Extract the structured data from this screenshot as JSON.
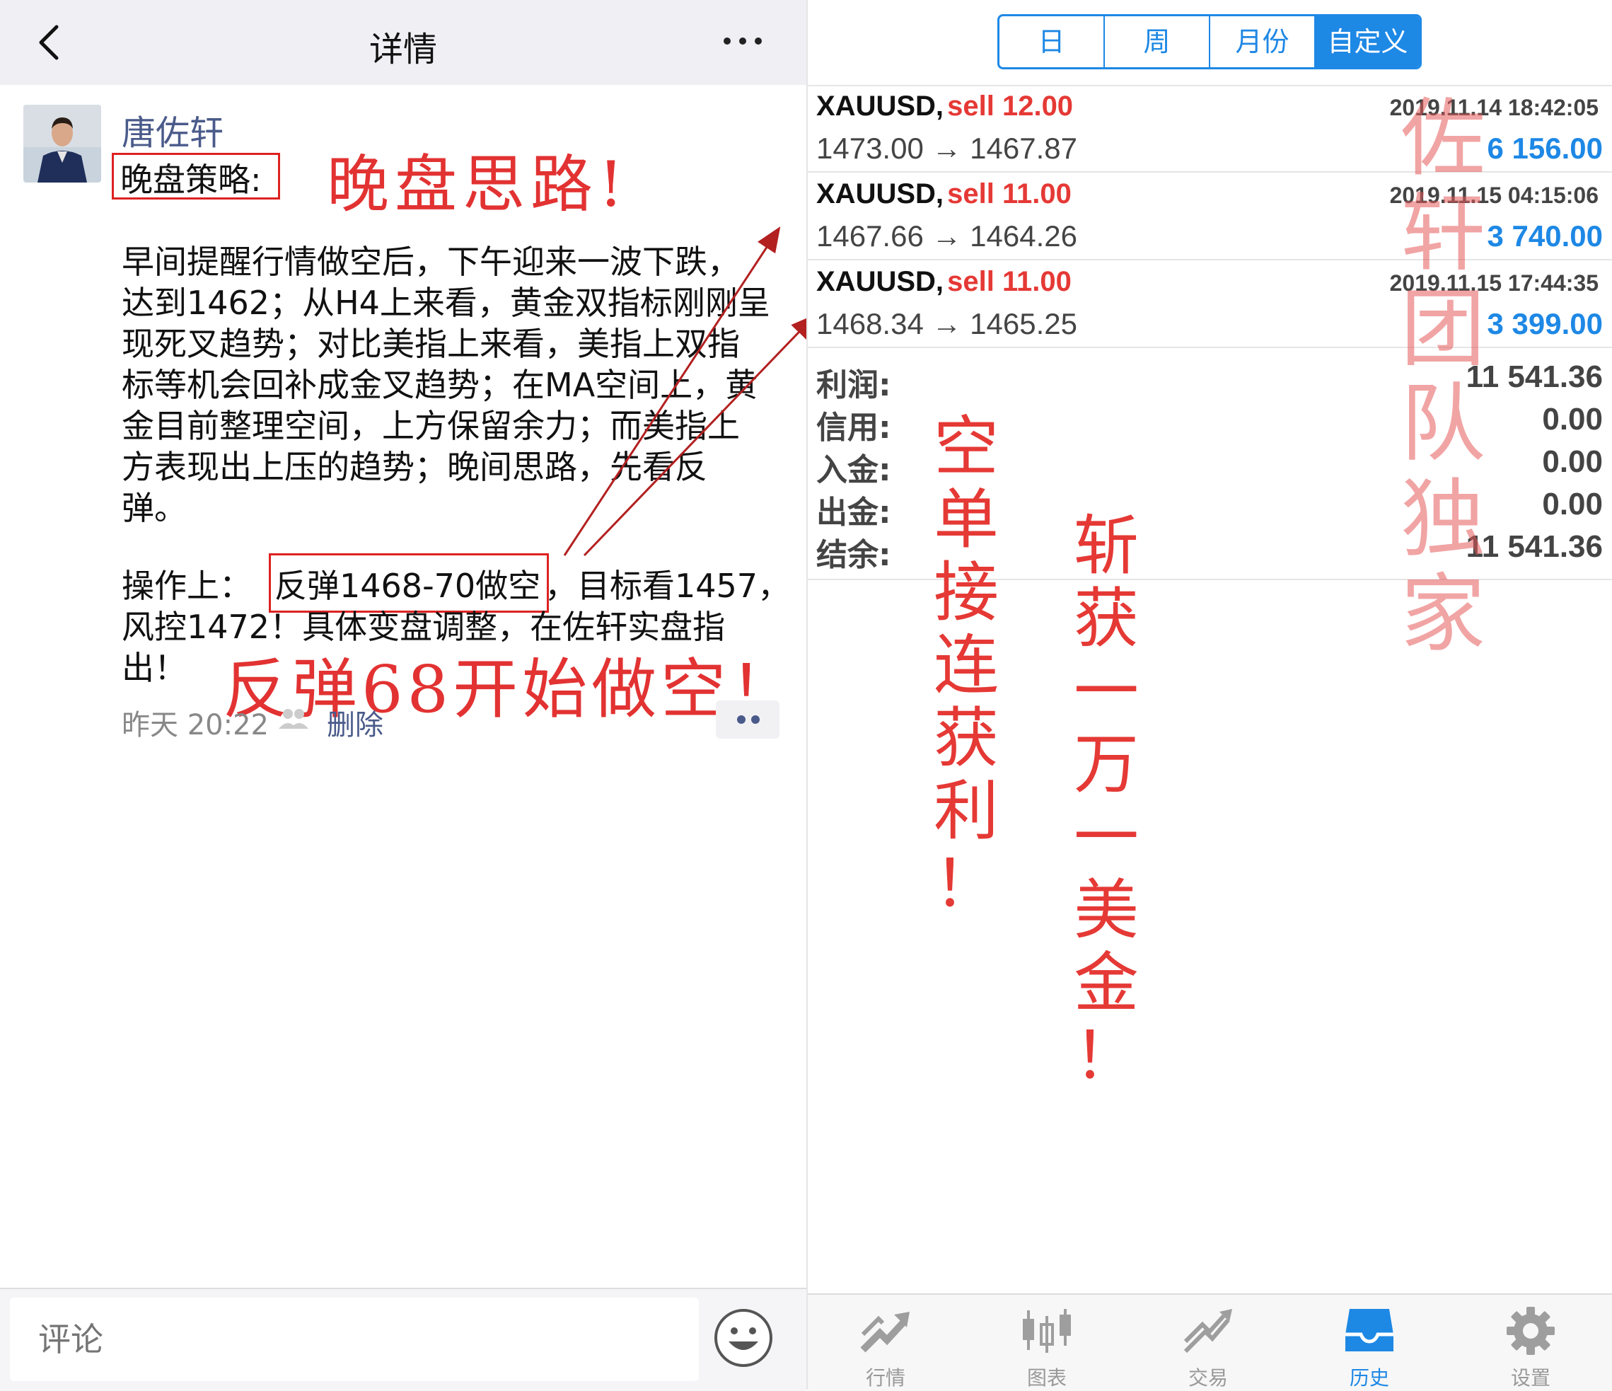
{
  "left": {
    "header": {
      "title": "详情"
    },
    "post": {
      "author": "唐佐轩",
      "strategy_label": "晚盘策略:",
      "annotation_evening": "晚盘思路!",
      "lines": [
        "  早间提醒行情做空后，下午迎来一波下跌，",
        "达到1462；从H4上来看，黄金双指标刚刚呈",
        "现死叉趋势；对比美指上来看，美指上双指",
        "标等机会回补成金叉趋势；在MA空间上，黄",
        "金目前整理空间，上方保留余力；而美指上",
        "方表现出上压的趋势；晚间思路，先看反",
        "弹。"
      ],
      "op_prefix": "  操作上：",
      "op_highlight": "反弹1468-70做空",
      "op_suffix": "，目标看1457，",
      "op_line2": "风控1472！具体变盘调整，在佐轩实盘指",
      "op_line3": "出！",
      "annotation_rebound": "反弹68开始做空！",
      "time": "昨天 20:22",
      "delete_label": "删除"
    },
    "footer": {
      "comment_placeholder": "评论"
    }
  },
  "right": {
    "segments": [
      {
        "label": "日",
        "active": false
      },
      {
        "label": "周",
        "active": false
      },
      {
        "label": "月份",
        "active": false
      },
      {
        "label": "自定义",
        "active": true
      }
    ],
    "deals": [
      {
        "symbol": "XAUUSD,",
        "side": "sell 12.00",
        "prices": "1473.00 → 1467.87",
        "time": "2019.11.14 18:42:05",
        "profit": "6 156.00"
      },
      {
        "symbol": "XAUUSD,",
        "side": "sell 11.00",
        "prices": "1467.66 → 1464.26",
        "time": "2019.11.15 04:15:06",
        "profit": "3 740.00"
      },
      {
        "symbol": "XAUUSD,",
        "side": "sell 11.00",
        "prices": "1468.34 → 1465.25",
        "time": "2019.11.15 17:44:35",
        "profit": "3 399.00"
      }
    ],
    "summary": [
      {
        "label": "利润:",
        "value": "11 541.36"
      },
      {
        "label": "信用:",
        "value": "0.00"
      },
      {
        "label": "入金:",
        "value": "0.00"
      },
      {
        "label": "出金:",
        "value": "0.00"
      },
      {
        "label": "结余:",
        "value": "11 541.36"
      }
    ],
    "annotation_1": "空单接连获利！",
    "annotation_2": "斩获一万一美金！",
    "watermark": "佐轩团队独家",
    "tabs": [
      {
        "label": "行情",
        "icon": "quotes-icon",
        "active": false
      },
      {
        "label": "图表",
        "icon": "chart-icon",
        "active": false
      },
      {
        "label": "交易",
        "icon": "trade-icon",
        "active": false
      },
      {
        "label": "历史",
        "icon": "history-icon",
        "active": true
      },
      {
        "label": "设置",
        "icon": "settings-icon",
        "active": false
      }
    ]
  },
  "colors": {
    "accent": "#1e88e5",
    "sell": "#e53935",
    "annotation": "#e23232",
    "link": "#4a5a8a"
  }
}
